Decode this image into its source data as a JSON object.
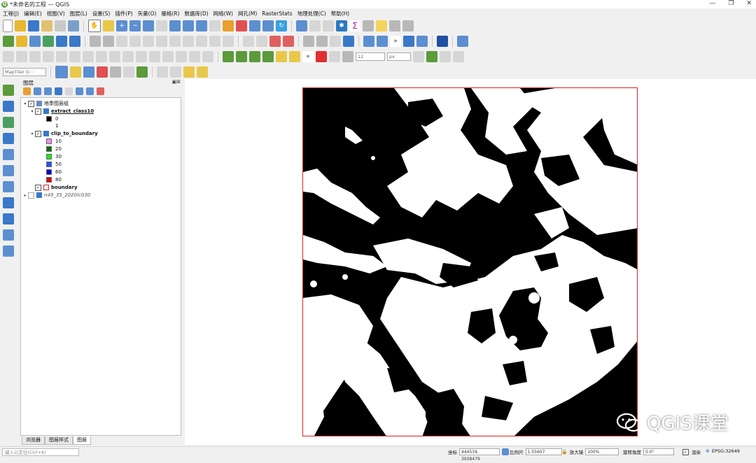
{
  "window": {
    "title": "*未命名的工程 — QGIS",
    "app_icon": "qgis-icon",
    "controls": [
      "minimize-icon",
      "restore-icon",
      "close-icon"
    ]
  },
  "menu": [
    "工程(J)",
    "编辑(E)",
    "视图(V)",
    "图层(L)",
    "设置(S)",
    "插件(P)",
    "矢量(O)",
    "栅格(R)",
    "数据库(D)",
    "网络(W)",
    "网孔(M)",
    "RasterStats",
    "地理处理(C)",
    "帮助(H)"
  ],
  "toolbar3": {
    "snap_tolerance": "12",
    "units": "px"
  },
  "toolbar4": {
    "maptiler_placeholder": "MapTiler G⋯"
  },
  "layers_panel": {
    "title": "图层",
    "group_name": "地季图层组",
    "layer1": {
      "name": "extract_class10",
      "classes": [
        {
          "label": "0",
          "color": "#000000"
        },
        {
          "label": "1",
          "color": "#ffffff"
        }
      ]
    },
    "layer2": {
      "name": "clip_to_boundary",
      "classes": [
        {
          "label": "10",
          "color": "#f08cf0"
        },
        {
          "label": "20",
          "color": "#0a6e0a"
        },
        {
          "label": "30",
          "color": "#1fe61f"
        },
        {
          "label": "50",
          "color": "#2255ff"
        },
        {
          "label": "60",
          "color": "#0000d8"
        },
        {
          "label": "80",
          "color": "#e00000"
        }
      ]
    },
    "layer3": {
      "name": "boundary"
    },
    "layer4": {
      "name": "n49_35_2020lc030"
    }
  },
  "tabs": [
    "浏览器",
    "图层样式",
    "图层"
  ],
  "watermark": "QGIS课堂",
  "status": {
    "locate_placeholder": "键入以定位(Ctrl+K)",
    "coord_label": "坐标",
    "coord_value": "444534, 3938479",
    "scale_label": "比例尺",
    "scale_value": "1:55607",
    "magnifier_label": "放大镜",
    "magnifier_value": "100%",
    "rotation_label": "旋转角度",
    "rotation_value": "0.0°",
    "render_label": "渲染",
    "epsg": "EPSG:32649"
  },
  "colors": {
    "map_border": "#dd2222",
    "map_black": "#000000",
    "map_white": "#ffffff"
  }
}
